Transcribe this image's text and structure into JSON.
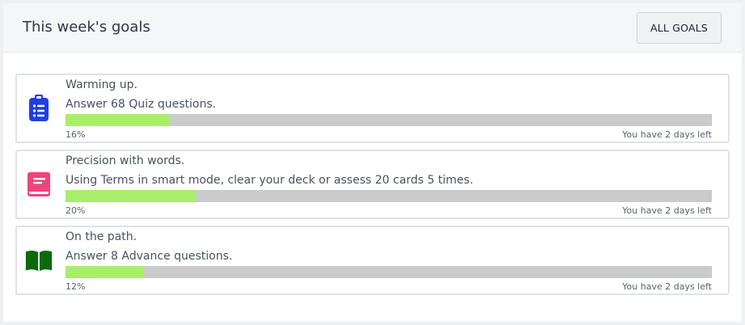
{
  "header": {
    "title": "This week's goals",
    "all_goals_label": "ALL GOALS"
  },
  "goals": [
    {
      "title": "Warming up.",
      "description": "Answer 68 Quiz questions.",
      "percent_label": "16%",
      "progress": 0.16,
      "deadline": "You have 2 days left",
      "icon": "clipboard-list-icon",
      "icon_color": "#1f3fe0"
    },
    {
      "title": "Precision with words.",
      "description": "Using Terms in smart mode, clear your deck or assess 20 cards 5 times.",
      "percent_label": "20%",
      "progress": 0.2,
      "deadline": "You have 2 days left",
      "icon": "book-icon",
      "icon_color": "#f0437a"
    },
    {
      "title": "On the path.",
      "description": "Answer 8 Advance questions.",
      "percent_label": "12%",
      "progress": 0.12,
      "deadline": "You have 2 days left",
      "icon": "open-book-icon",
      "icon_color": "#0b6a0b"
    }
  ],
  "colors": {
    "progress_fill": "#a8ee6b",
    "progress_track": "#cbcbcb"
  }
}
